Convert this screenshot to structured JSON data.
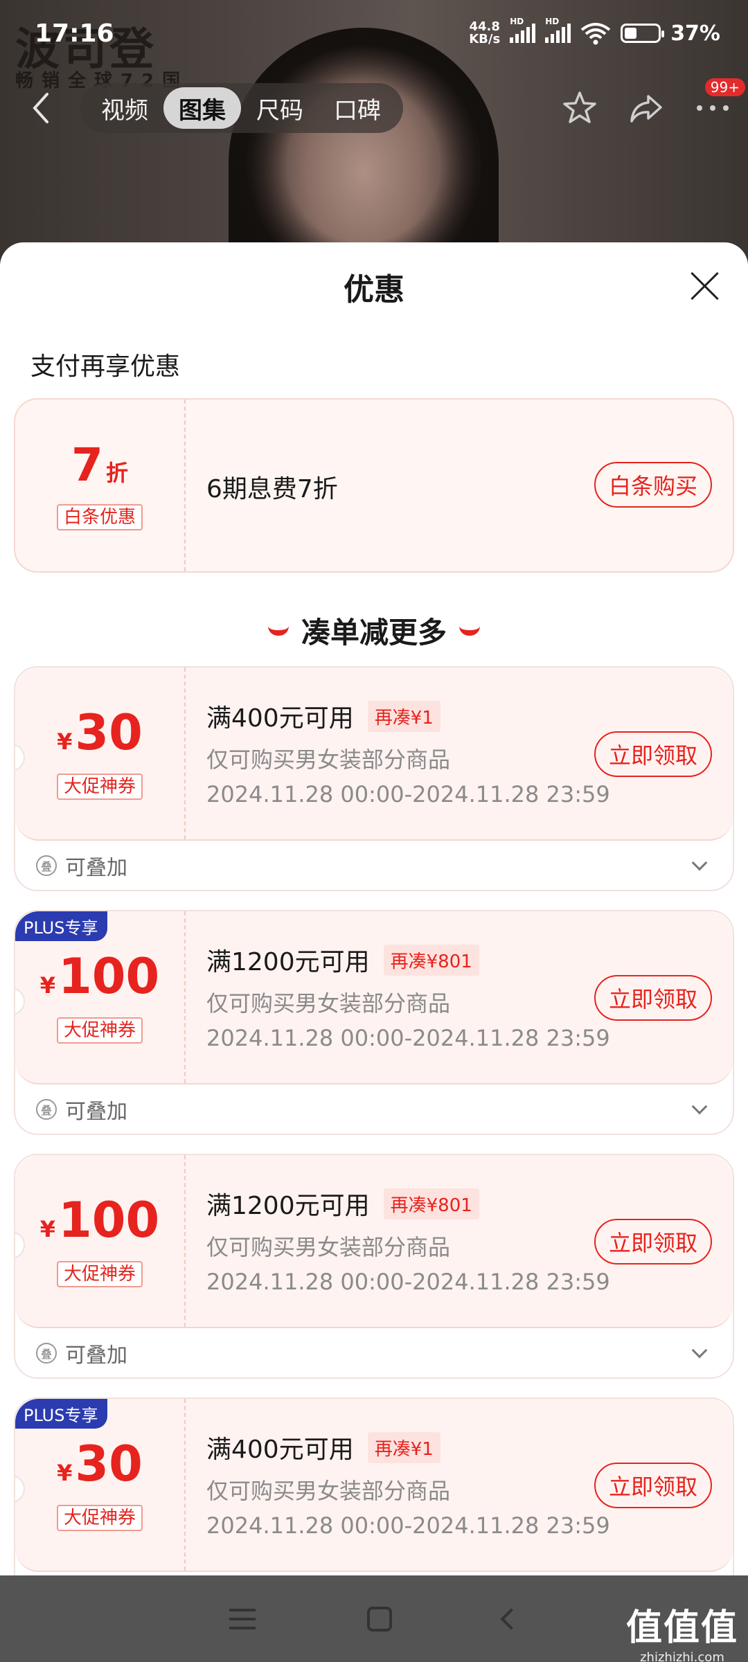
{
  "status_bar": {
    "time": "17:16",
    "net_speed_value": "44.8",
    "net_speed_unit": "KB/s",
    "signal_hd_label": "HD",
    "battery_percent": "37%",
    "battery_level": 0.37
  },
  "product": {
    "brand_name": "波司登",
    "brand_tagline": "畅销全球72国"
  },
  "nav": {
    "tabs": [
      {
        "label": "视频",
        "active": false
      },
      {
        "label": "图集",
        "active": true
      },
      {
        "label": "尺码",
        "active": false
      },
      {
        "label": "口碑",
        "active": false
      }
    ],
    "more_badge": "99+"
  },
  "sheet": {
    "title": "优惠",
    "payment_section_label": "支付再享优惠",
    "payment_offer": {
      "discount_number": "7",
      "discount_unit": "折",
      "tag": "白条优惠",
      "description": "6期息费7折",
      "button_label": "白条购买"
    },
    "coupon_section_heading": "凑单减更多",
    "coupons": [
      {
        "plus_label": "",
        "currency": "¥",
        "amount": "30",
        "tag": "大促神券",
        "condition": "满400元可用",
        "need_more": "再凑¥1",
        "scope": "仅可购买男女装部分商品",
        "validity": "2024.11.28 00:00-2024.11.28 23:59",
        "button_label": "立即领取",
        "stack_label": "可叠加",
        "stack_icon_char": "叠"
      },
      {
        "plus_label": "PLUS专享",
        "currency": "¥",
        "amount": "100",
        "tag": "大促神券",
        "condition": "满1200元可用",
        "need_more": "再凑¥801",
        "scope": "仅可购买男女装部分商品",
        "validity": "2024.11.28 00:00-2024.11.28 23:59",
        "button_label": "立即领取",
        "stack_label": "可叠加",
        "stack_icon_char": "叠"
      },
      {
        "plus_label": "",
        "currency": "¥",
        "amount": "100",
        "tag": "大促神券",
        "condition": "满1200元可用",
        "need_more": "再凑¥801",
        "scope": "仅可购买男女装部分商品",
        "validity": "2024.11.28 00:00-2024.11.28 23:59",
        "button_label": "立即领取",
        "stack_label": "可叠加",
        "stack_icon_char": "叠"
      },
      {
        "plus_label": "PLUS专享",
        "currency": "¥",
        "amount": "30",
        "tag": "大促神券",
        "condition": "满400元可用",
        "need_more": "再凑¥1",
        "scope": "仅可购买男女装部分商品",
        "validity": "2024.11.28 00:00-2024.11.28 23:59",
        "button_label": "立即领取",
        "stack_label": "",
        "stack_icon_char": ""
      }
    ]
  },
  "watermark": {
    "main": "值值值",
    "site": "zhizhizhi.com"
  },
  "colors": {
    "accent_red": "#e6231e",
    "plus_blue": "#2b3bb0",
    "coupon_bg": "#fff3f1"
  },
  "icons": {
    "back": "chevron-left-icon",
    "favorite": "star-icon",
    "share": "share-icon",
    "more": "more-dots-icon",
    "close": "close-icon",
    "stack": "stack-icon",
    "expand": "chevron-down-icon"
  }
}
